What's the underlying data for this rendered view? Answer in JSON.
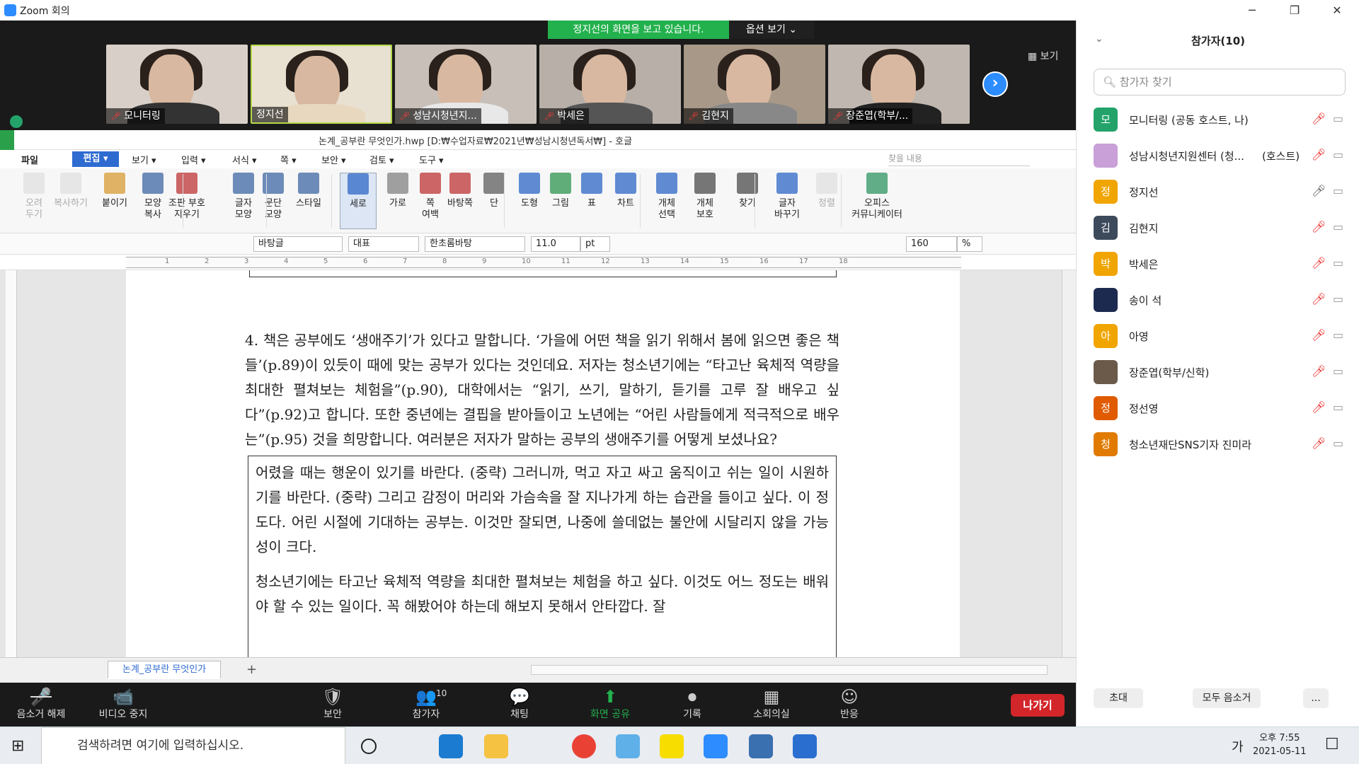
{
  "zoom_window": {
    "title": "Zoom 회의",
    "controls": [
      "─",
      "❐",
      "✕"
    ]
  },
  "share_banner": {
    "message": "정지선의 화면을 보고 있습니다.",
    "options_label": "옵션 보기 ⌄"
  },
  "video_tiles": [
    {
      "name": "모니터링",
      "muted": true
    },
    {
      "name": "정지선",
      "muted": false
    },
    {
      "name": "성남시청년지...",
      "muted": true
    },
    {
      "name": "박세은",
      "muted": true
    },
    {
      "name": "김현지",
      "muted": true
    },
    {
      "name": "장준엽(학부/...",
      "muted": true
    }
  ],
  "view_button": "▦ 보기",
  "hwp": {
    "title": "논계_공부란 무엇인가.hwp [D:₩수업자료₩2021년₩성남시청년독서₩] - 호글",
    "menu": [
      "파일",
      "편집 ▾",
      "보기 ▾",
      "입력 ▾",
      "서식 ▾",
      "쪽 ▾",
      "보안 ▾",
      "검토 ▾",
      "도구 ▾"
    ],
    "search_placeholder": "찾을 내용",
    "ribbon": [
      {
        "label": "오려\n두기",
        "dim": true
      },
      {
        "label": "복사하기",
        "dim": true
      },
      {
        "label": "붙이기",
        "dim": false
      },
      {
        "label": "모양\n복사",
        "dim": false
      },
      {
        "label": "조판 부호\n지우기",
        "dim": false
      },
      {
        "label": "글자\n모양",
        "dim": false
      },
      {
        "label": "문단\n모양",
        "dim": false
      },
      {
        "label": "스타일",
        "dim": false
      },
      {
        "label": "세로",
        "dim": false
      },
      {
        "label": "가로",
        "dim": false
      },
      {
        "label": "쪽\n여백",
        "dim": false
      },
      {
        "label": "바탕쪽",
        "dim": false
      },
      {
        "label": "단",
        "dim": false
      },
      {
        "label": "도형",
        "dim": false
      },
      {
        "label": "그림",
        "dim": false
      },
      {
        "label": "표",
        "dim": false
      },
      {
        "label": "차트",
        "dim": false
      },
      {
        "label": "개체\n선택",
        "dim": false
      },
      {
        "label": "개체\n보호",
        "dim": false
      },
      {
        "label": "찾기",
        "dim": false
      },
      {
        "label": "글자\n바꾸기",
        "dim": false
      },
      {
        "label": "정렬",
        "dim": true
      },
      {
        "label": "오피스\n커뮤니케이터",
        "dim": false
      }
    ],
    "toolbar": {
      "style": "바탕글",
      "lang": "대표",
      "font": "한초롬바탕",
      "size": "11.0",
      "size_unit": "pt",
      "zoom": "160",
      "zoom_unit": "%"
    },
    "ruler_ticks": [
      "1",
      "2",
      "3",
      "4",
      "5",
      "6",
      "7",
      "8",
      "9",
      "10",
      "11",
      "12",
      "13",
      "14",
      "15",
      "16",
      "17",
      "18"
    ],
    "question_text": "4. 책은 공부에도 ‘생애주기’가 있다고 말합니다. ‘가을에 어떤 책을 읽기 위해서 봄에 읽으면 좋은 책들’(p.89)이 있듯이 때에 맞는 공부가 있다는 것인데요. 저자는 청소년기에는 “타고난 육체적 역량을 최대한 펼쳐보는 체험을”(p.90), 대학에서는 “읽기, 쓰기, 말하기, 듣기를 고루 잘 배우고 싶다”(p.92)고 합니다. 또한 중년에는 결핍을 받아들이고 노년에는 “어린 사람들에게 적극적으로 배우는”(p.95) 것을 희망합니다. 여러분은 저자가 말하는 공부의 생애주기를 어떻게 보셨나요?",
    "quote_paragraphs": [
      "어렸을 때는 행운이 있기를 바란다. (중략) 그러니까, 먹고 자고 싸고 움직이고 쉬는 일이 시원하기를 바란다. (중략) 그리고 감정이 머리와 가슴속을 잘 지나가게 하는 습관을 들이고 싶다. 이 정도다. 어린 시절에 기대하는 공부는. 이것만 잘되면, 나중에 쓸데없는 불안에 시달리지 않을 가능성이 크다.",
      "청소년기에는 타고난 육체적 역량을 최대한 펼쳐보는 체험을 하고 싶다. 이것도 어느 정도는 배워야 할 수 있는 일이다. 꼭 해봤어야 하는데 해보지 못해서 안타깝다. 잘"
    ],
    "doc_tab": "논계_공부란 무엇인가"
  },
  "zoom_controls": [
    {
      "icon": "🎤",
      "label": "음소거 해제"
    },
    {
      "icon": "📹",
      "label": "비디오 중지"
    },
    {
      "icon": "🛡",
      "label": "보안"
    },
    {
      "icon": "👥",
      "label": "참가자",
      "count": "10"
    },
    {
      "icon": "💬",
      "label": "채팅"
    },
    {
      "icon": "⬆",
      "label": "화면 공유"
    },
    {
      "icon": "⏺",
      "label": "기록"
    },
    {
      "icon": "▦",
      "label": "소회의실"
    },
    {
      "icon": "☺",
      "label": "반응"
    }
  ],
  "leave_label": "나가기",
  "participants_panel": {
    "title": "참가자(10)",
    "search_placeholder": "참가자 찾기",
    "participants": [
      {
        "initial": "모",
        "name": "모니터링 (공동 호스트, 나)",
        "role": "",
        "color": "#23a36a",
        "mic": "muted"
      },
      {
        "initial": "",
        "name": "성남시청년지원센터 (청...",
        "role": "(호스트)",
        "color": "#c9a0d8",
        "mic": "muted"
      },
      {
        "initial": "정",
        "name": "정지선",
        "role": "",
        "color": "#f0a500",
        "mic": "on"
      },
      {
        "initial": "김",
        "name": "김현지",
        "role": "",
        "color": "#3d4a5c",
        "mic": "muted"
      },
      {
        "initial": "박",
        "name": "박세은",
        "role": "",
        "color": "#f0a500",
        "mic": "muted"
      },
      {
        "initial": "",
        "name": "송이 석",
        "role": "",
        "color": "#1c2a50",
        "mic": "muted"
      },
      {
        "initial": "아",
        "name": "아영",
        "role": "",
        "color": "#f0a500",
        "mic": "muted"
      },
      {
        "initial": "",
        "name": "장준엽(학부/신학)",
        "role": "",
        "color": "#6b5a4a",
        "mic": "muted"
      },
      {
        "initial": "정",
        "name": "정선영",
        "role": "",
        "color": "#e05a00",
        "mic": "muted"
      },
      {
        "initial": "청",
        "name": "청소년재단SNS기자 진미라",
        "role": "",
        "color": "#e07a00",
        "mic": "muted"
      }
    ],
    "footer": [
      "초대",
      "모두 음소거",
      "..."
    ]
  },
  "taskbar": {
    "search_placeholder": "검색하려면 여기에 입력하십시오.",
    "ime": "가",
    "time": "오후 7:55",
    "date": "2021-05-11"
  }
}
